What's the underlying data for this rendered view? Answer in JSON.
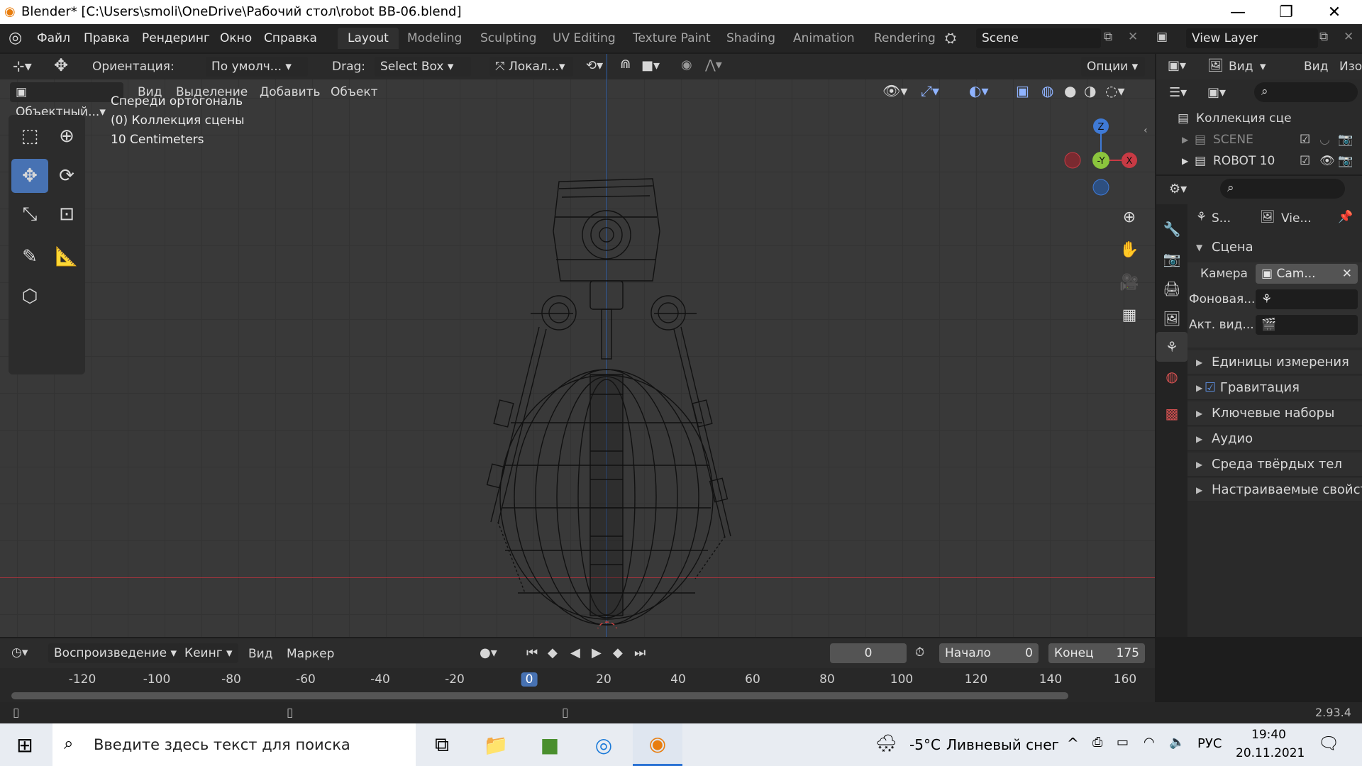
{
  "window": {
    "title": "Blender* [C:\\Users\\smoli\\OneDrive\\Рабочий стол\\robot BB-06.blend]",
    "minimize": "—",
    "maximize": "❐",
    "close": "✕"
  },
  "menu": [
    "Файл",
    "Правка",
    "Рендеринг",
    "Окно",
    "Справка"
  ],
  "workspaces": [
    "Layout",
    "Modeling",
    "Sculpting",
    "UV Editing",
    "Texture Paint",
    "Shading",
    "Animation",
    "Rendering"
  ],
  "scene_name": "Scene",
  "view_layer": "View Layer",
  "tool_header": {
    "orientation_label": "Ориентация:",
    "orientation_value": "По умолч...",
    "drag_label": "Drag:",
    "drag_value": "Select Box",
    "pivot_value": "Локал...",
    "options": "Опции"
  },
  "viewport_header": {
    "mode": "Объектный...",
    "items": [
      "Вид",
      "Выделение",
      "Добавить",
      "Объект"
    ]
  },
  "viewport_overlay": {
    "line1": "Спереди ортогональ",
    "line2": "(0) Коллекция сцены",
    "line3": "10 Centimeters"
  },
  "gizmo": {
    "z": "Z",
    "y": "-Y",
    "x": "X"
  },
  "outliner": {
    "header_view": "Вид",
    "header_image": "Изоб",
    "root": "Коллекция сце",
    "items": [
      {
        "name": "SCENE"
      },
      {
        "name": "ROBOT 10"
      }
    ]
  },
  "properties": {
    "breadcrumb_scene": "S...",
    "breadcrumb_view": "Vie...",
    "section_scene": "Сцена",
    "camera_label": "Камера",
    "camera_value": "Cam...",
    "background_label": "Фоновая...",
    "active_clip_label": "Акт. вид...",
    "sections": [
      "Единицы измерения",
      "Гравитация",
      "Ключевые наборы",
      "Аудио",
      "Среда твёрдых тел",
      "Настраиваемые свойст"
    ]
  },
  "timeline": {
    "playback": "Воспроизведение",
    "keying": "Кеинг",
    "view": "Вид",
    "marker": "Маркер",
    "current_frame": "0",
    "start_label": "Начало",
    "start_value": "0",
    "end_label": "Конец",
    "end_value": "175",
    "ticks": [
      "-120",
      "-100",
      "-80",
      "-60",
      "-40",
      "-20",
      "0",
      "20",
      "40",
      "60",
      "80",
      "100",
      "120",
      "140",
      "160"
    ]
  },
  "status": {
    "version": "2.93.4"
  },
  "taskbar": {
    "search_placeholder": "Введите здесь текст для поиска",
    "weather_temp": "-5°C",
    "weather_text": "Ливневый снег",
    "lang": "РУС",
    "time": "19:40",
    "date": "20.11.2021"
  },
  "colors": {
    "accent": "#4772b3",
    "x_axis": "#c83a44",
    "y_axis": "#8bc53d",
    "z_axis": "#3f7ad6"
  }
}
